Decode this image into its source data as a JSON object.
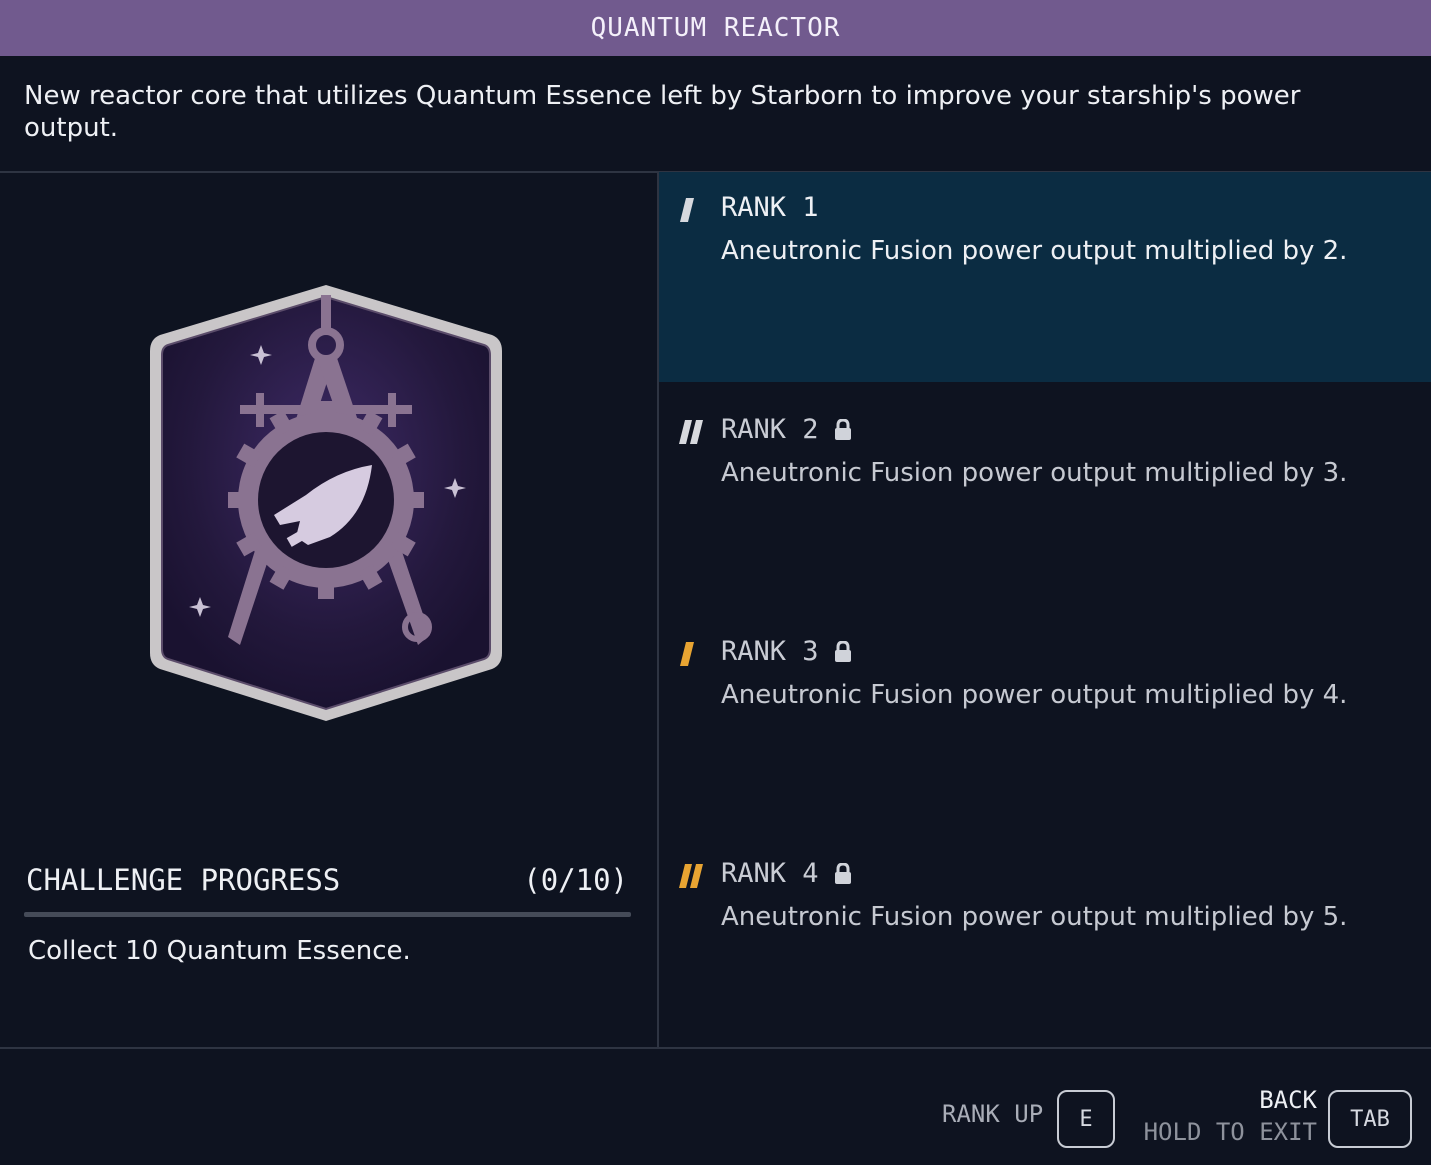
{
  "title": "QUANTUM REACTOR",
  "description": "New reactor core that utilizes Quantum Essence left by Starborn to improve your starship's power output.",
  "colors": {
    "title_bar": "#715a8e",
    "background": "#0e1320",
    "selected_rank": "#0b2c42",
    "tier_orange": "#e8a432",
    "tier_white": "#d7d9de",
    "badge_purple": "#2c1e4a",
    "badge_emblem": "#8a7391"
  },
  "badge": {
    "icon": "starship-design-patch-icon"
  },
  "challenge": {
    "label": "CHALLENGE PROGRESS",
    "count": "(0/10)",
    "progress": 0,
    "task": "Collect 10 Quantum Essence."
  },
  "ranks": [
    {
      "title": "RANK 1",
      "description": "Aneutronic Fusion power output multiplied by 2.",
      "locked": false,
      "selected": true,
      "tier_color": "white",
      "tier_bars": 1
    },
    {
      "title": "RANK 2",
      "description": "Aneutronic Fusion power output multiplied by 3.",
      "locked": true,
      "selected": false,
      "tier_color": "white",
      "tier_bars": 2
    },
    {
      "title": "RANK 3",
      "description": "Aneutronic Fusion power output multiplied by 4.",
      "locked": true,
      "selected": false,
      "tier_color": "orange",
      "tier_bars": 1
    },
    {
      "title": "RANK 4",
      "description": "Aneutronic Fusion power output multiplied by 5.",
      "locked": true,
      "selected": false,
      "tier_color": "orange",
      "tier_bars": 2
    }
  ],
  "footer": {
    "rank_up_label": "RANK UP",
    "rank_up_key": "E",
    "back_label": "BACK",
    "hold_label": "HOLD TO EXIT",
    "back_key": "TAB"
  }
}
